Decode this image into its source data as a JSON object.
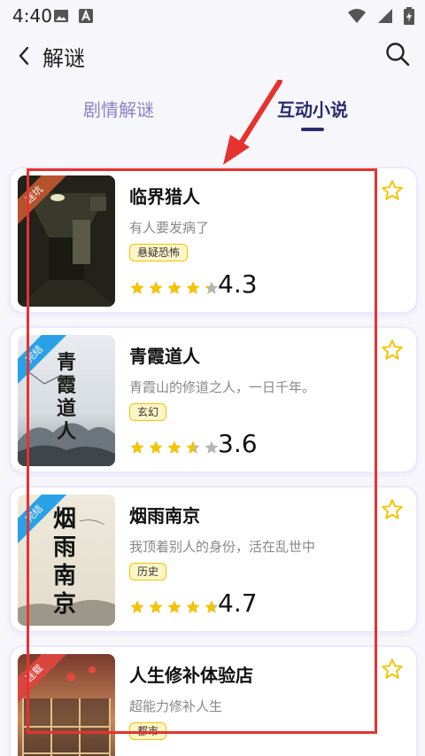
{
  "status_bar": {
    "time": "4:40"
  },
  "app_bar": {
    "title": "解谜"
  },
  "tabs": [
    {
      "label": "剧情解谜",
      "active": false
    },
    {
      "label": "互动小说",
      "active": true
    }
  ],
  "colors": {
    "accent": "#2b2b6e",
    "tab_inactive": "#8a82c8",
    "star": "#f4c400",
    "star_empty": "#b5b5b5",
    "annotation": "#e6322f"
  },
  "books": [
    {
      "title": "临界猎人",
      "description": "有人要发病了",
      "tag": "悬疑恐怖",
      "rating": "4.3",
      "stars": 4.3,
      "ribbon": "连坑",
      "ribbon_color": "#b5532e",
      "cover_text": ""
    },
    {
      "title": "青霞道人",
      "description": "青霞山的修道之人，一日千年。",
      "tag": "玄幻",
      "rating": "3.6",
      "stars": 3.6,
      "ribbon": "完结",
      "ribbon_color": "#2aa1e6",
      "cover_text": "青霞道人"
    },
    {
      "title": "烟雨南京",
      "description": "我顶着别人的身份，活在乱世中",
      "tag": "历史",
      "rating": "4.7",
      "stars": 4.7,
      "ribbon": "完结",
      "ribbon_color": "#2aa1e6",
      "cover_text": "烟雨南京"
    },
    {
      "title": "人生修补体验店",
      "description": "超能力修补人生",
      "tag": "都市",
      "rating": "",
      "stars": 0,
      "ribbon": "连载",
      "ribbon_color": "#d8463e",
      "cover_text": ""
    }
  ]
}
